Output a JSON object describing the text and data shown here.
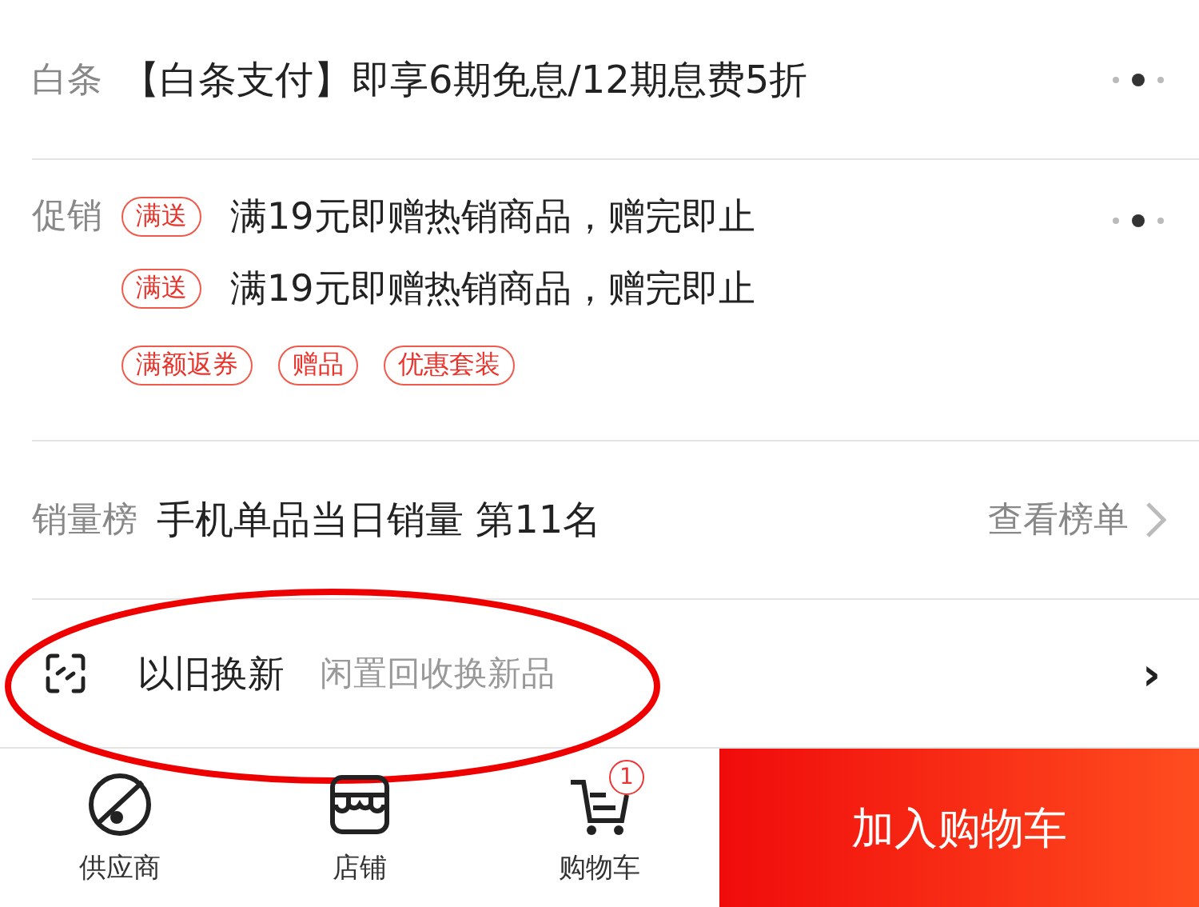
{
  "baitiao": {
    "label": "白条",
    "text": "【白条支付】即享6期免息/12期息费5折"
  },
  "promotion": {
    "label": "促销",
    "offers": [
      {
        "tag": "满送",
        "text": "满19元即赠热销商品，赠完即止"
      },
      {
        "tag": "满送",
        "text": "满19元即赠热销商品，赠完即止"
      }
    ],
    "tags": [
      "满额返券",
      "赠品",
      "优惠套装"
    ]
  },
  "ranking": {
    "label": "销量榜",
    "text": "手机单品当日销量 第11名",
    "link": "查看榜单"
  },
  "trade_in": {
    "title": "以旧换新",
    "subtitle": "闲置回收换新品",
    "chevron": "›"
  },
  "bottom_bar": {
    "items": [
      {
        "kind": "supplier",
        "label": "供应商"
      },
      {
        "kind": "store",
        "label": "店铺"
      },
      {
        "kind": "cart",
        "label": "购物车",
        "badge": "1"
      }
    ],
    "button": "加入购物车"
  }
}
